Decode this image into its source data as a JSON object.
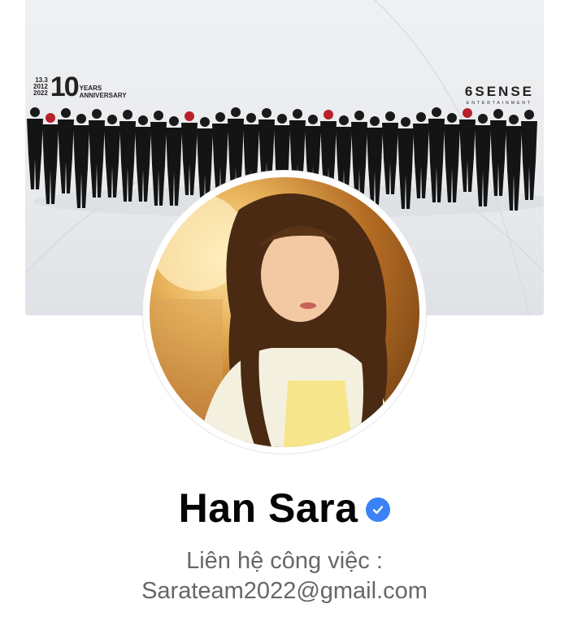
{
  "cover": {
    "anniversary_dates": "13.3\n2012\n2022",
    "anniversary_number": "10",
    "anniversary_text": "YEARS\nANNIVERSARY",
    "brand_name": "6SENSE",
    "brand_sub": "ENTERTAINMENT"
  },
  "profile": {
    "name": "Han Sara",
    "verified": true,
    "bio_line1": "Liên hệ công việc :",
    "bio_line2": "Sarateam2022@gmail.com"
  },
  "colors": {
    "verified_badge": "#3b82f6",
    "name_text": "#050505",
    "bio_text": "#65676b"
  }
}
